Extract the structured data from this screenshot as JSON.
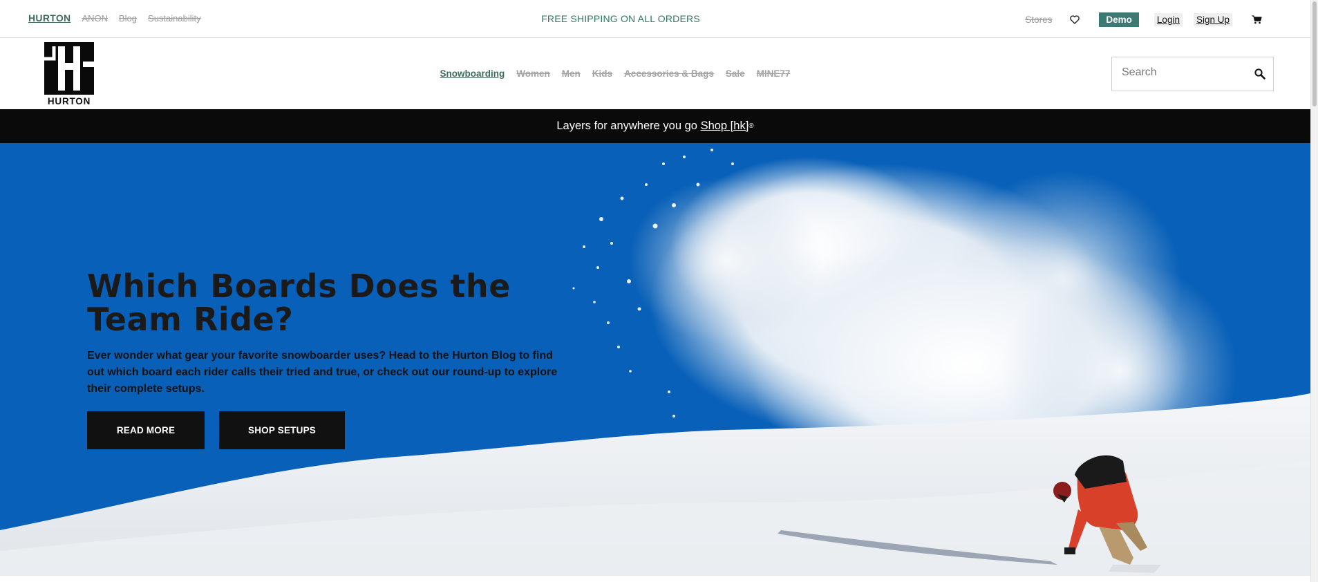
{
  "utility": {
    "brand_links": [
      "HURTON",
      "ANON",
      "Blog",
      "Sustainability"
    ],
    "promo": "FREE SHIPPING ON ALL ORDERS",
    "stores": "Stores",
    "demo": "Demo",
    "login": "Login",
    "signup": "Sign Up",
    "icons": [
      "heart-icon",
      "cart-icon"
    ]
  },
  "header": {
    "logo_text": "HURTON",
    "nav": [
      "Snowboarding",
      "Women",
      "Men",
      "Kids",
      "Accessories & Bags",
      "Sale",
      "MINE77"
    ],
    "search_placeholder": "Search"
  },
  "announcement": {
    "text": "Layers for anywhere you go",
    "link": "Shop [hk]",
    "mark": "®"
  },
  "hero": {
    "title": "Which Boards Does the Team Ride?",
    "body": "Ever wonder what gear your favorite snowboarder uses? Head to the Hurton Blog to find out which board each rider calls their tried and true, or check out our round-up to explore their complete setups.",
    "buttons": [
      "READ MORE",
      "SHOP SETUPS"
    ]
  },
  "colors": {
    "accent_green": "#3f6b5c",
    "promo_green": "#2d7a5c",
    "demo_teal": "#3a7a73",
    "sky_blue": "#0860b8",
    "announcement_bg": "#0a0a0a"
  }
}
